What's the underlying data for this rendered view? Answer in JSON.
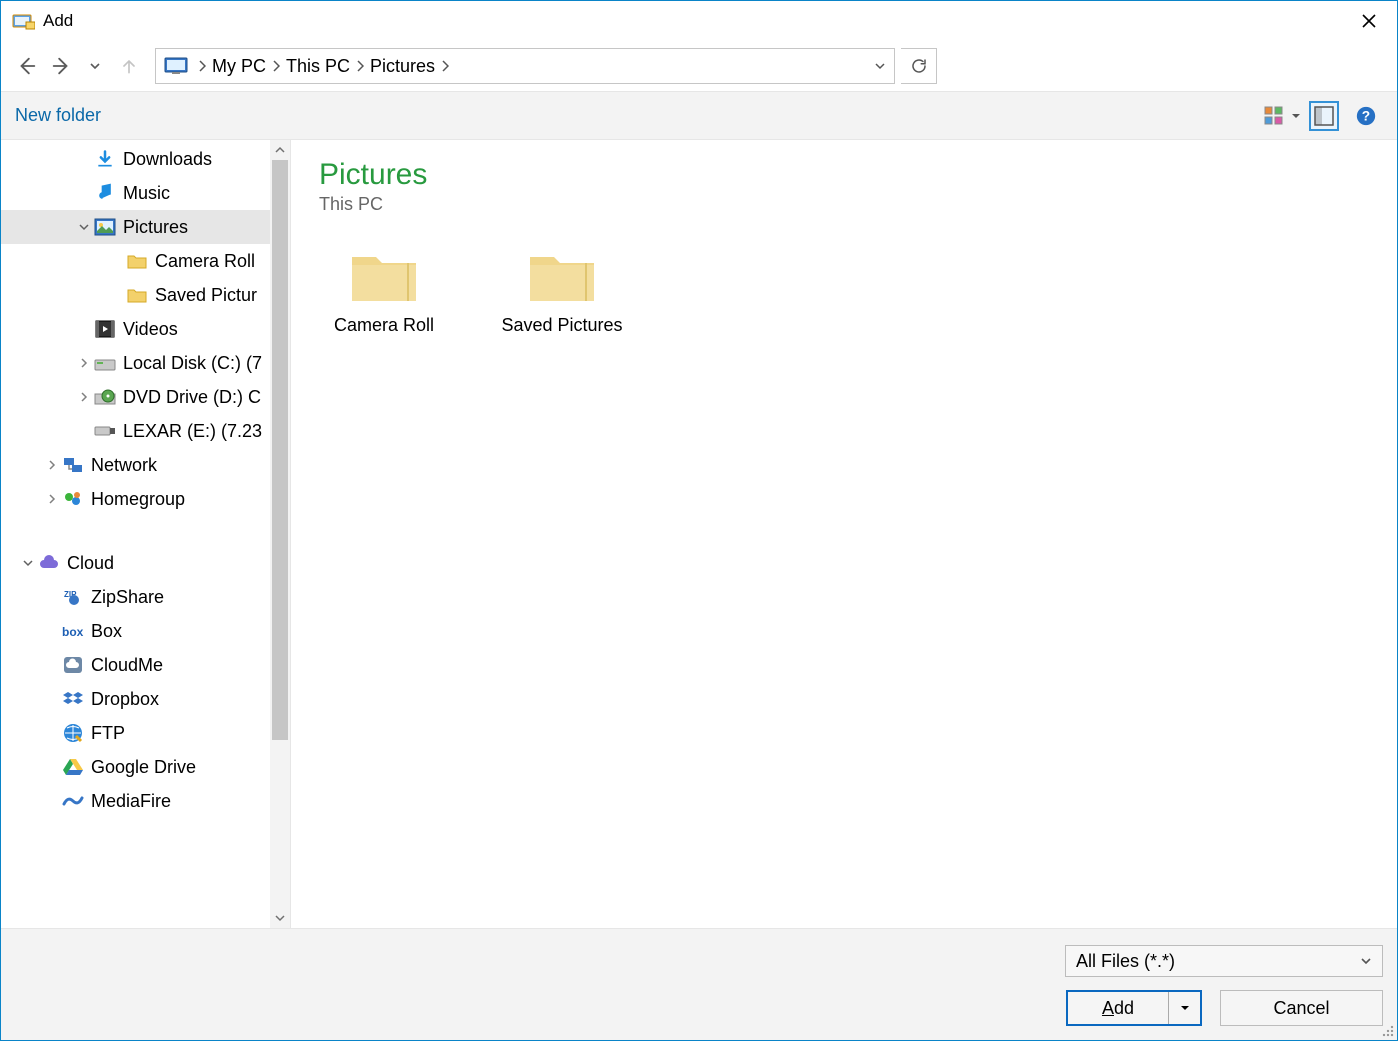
{
  "title": "Add",
  "breadcrumbs": [
    "My PC",
    "This PC",
    "Pictures"
  ],
  "toolbar": {
    "new_folder": "New folder"
  },
  "header": {
    "title": "Pictures",
    "subtitle": "This PC"
  },
  "folders": [
    {
      "label": "Camera Roll"
    },
    {
      "label": "Saved Pictures"
    }
  ],
  "filter": {
    "selected": "All Files (*.*)"
  },
  "buttons": {
    "add": "Add",
    "cancel": "Cancel"
  },
  "tree": {
    "downloads": "Downloads",
    "music": "Music",
    "pictures": "Pictures",
    "camera_roll": "Camera Roll",
    "saved_pictures": "Saved Pictur",
    "videos": "Videos",
    "local_disk": "Local Disk (C:) (7",
    "dvd": "DVD Drive (D:) C",
    "lexar": "LEXAR (E:) (7.23",
    "network": "Network",
    "homegroup": "Homegroup",
    "cloud": "Cloud",
    "zipshare": "ZipShare",
    "box": "Box",
    "cloudme": "CloudMe",
    "dropbox": "Dropbox",
    "ftp": "FTP",
    "gdrive": "Google Drive",
    "mediafire": "MediaFire"
  }
}
